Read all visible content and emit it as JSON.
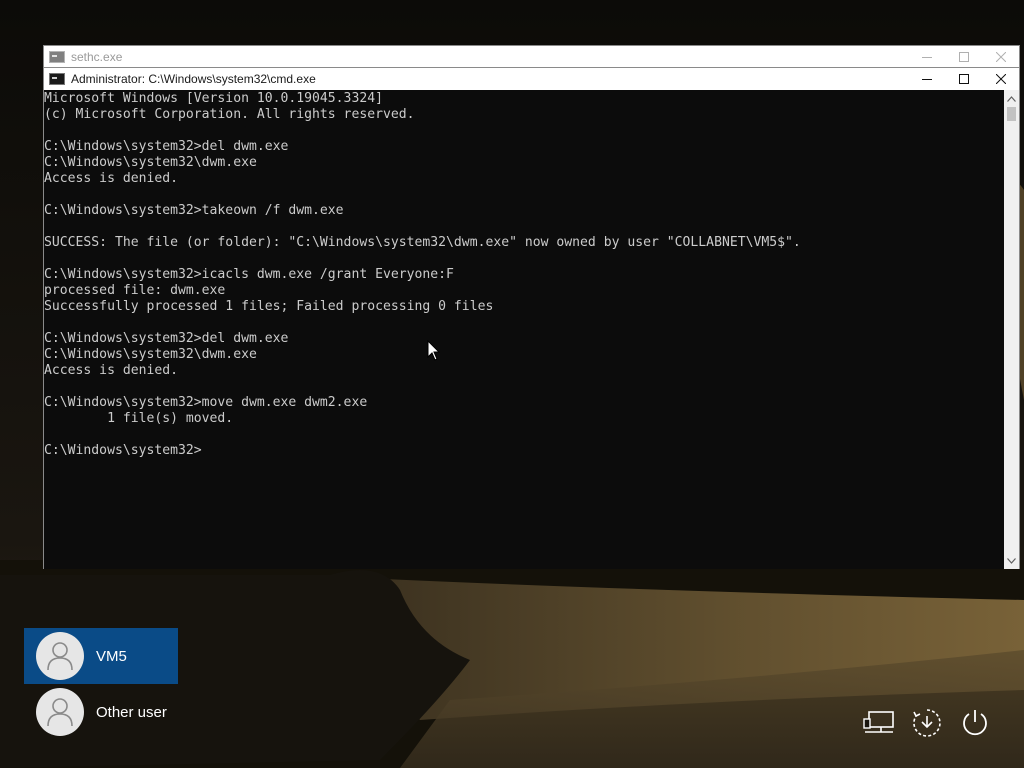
{
  "sethc_window": {
    "title": "sethc.exe"
  },
  "cmd_window": {
    "title": "Administrator: C:\\Windows\\system32\\cmd.exe",
    "lines": [
      "Microsoft Windows [Version 10.0.19045.3324]",
      "(c) Microsoft Corporation. All rights reserved.",
      "",
      "C:\\Windows\\system32>del dwm.exe",
      "C:\\Windows\\system32\\dwm.exe",
      "Access is denied.",
      "",
      "C:\\Windows\\system32>takeown /f dwm.exe",
      "",
      "SUCCESS: The file (or folder): \"C:\\Windows\\system32\\dwm.exe\" now owned by user \"COLLABNET\\VM5$\".",
      "",
      "C:\\Windows\\system32>icacls dwm.exe /grant Everyone:F",
      "processed file: dwm.exe",
      "Successfully processed 1 files; Failed processing 0 files",
      "",
      "C:\\Windows\\system32>del dwm.exe",
      "C:\\Windows\\system32\\dwm.exe",
      "Access is denied.",
      "",
      "C:\\Windows\\system32>move dwm.exe dwm2.exe",
      "        1 file(s) moved.",
      "",
      "C:\\Windows\\system32>"
    ]
  },
  "users": [
    {
      "name": "VM5",
      "selected": true
    },
    {
      "name": "Other user",
      "selected": false
    }
  ],
  "system_icons": [
    "network-icon",
    "accessibility-icon",
    "power-icon"
  ],
  "colors": {
    "selected_user": "#0a4b87",
    "console_bg": "#0c0c0c",
    "console_text": "#cccccc"
  }
}
